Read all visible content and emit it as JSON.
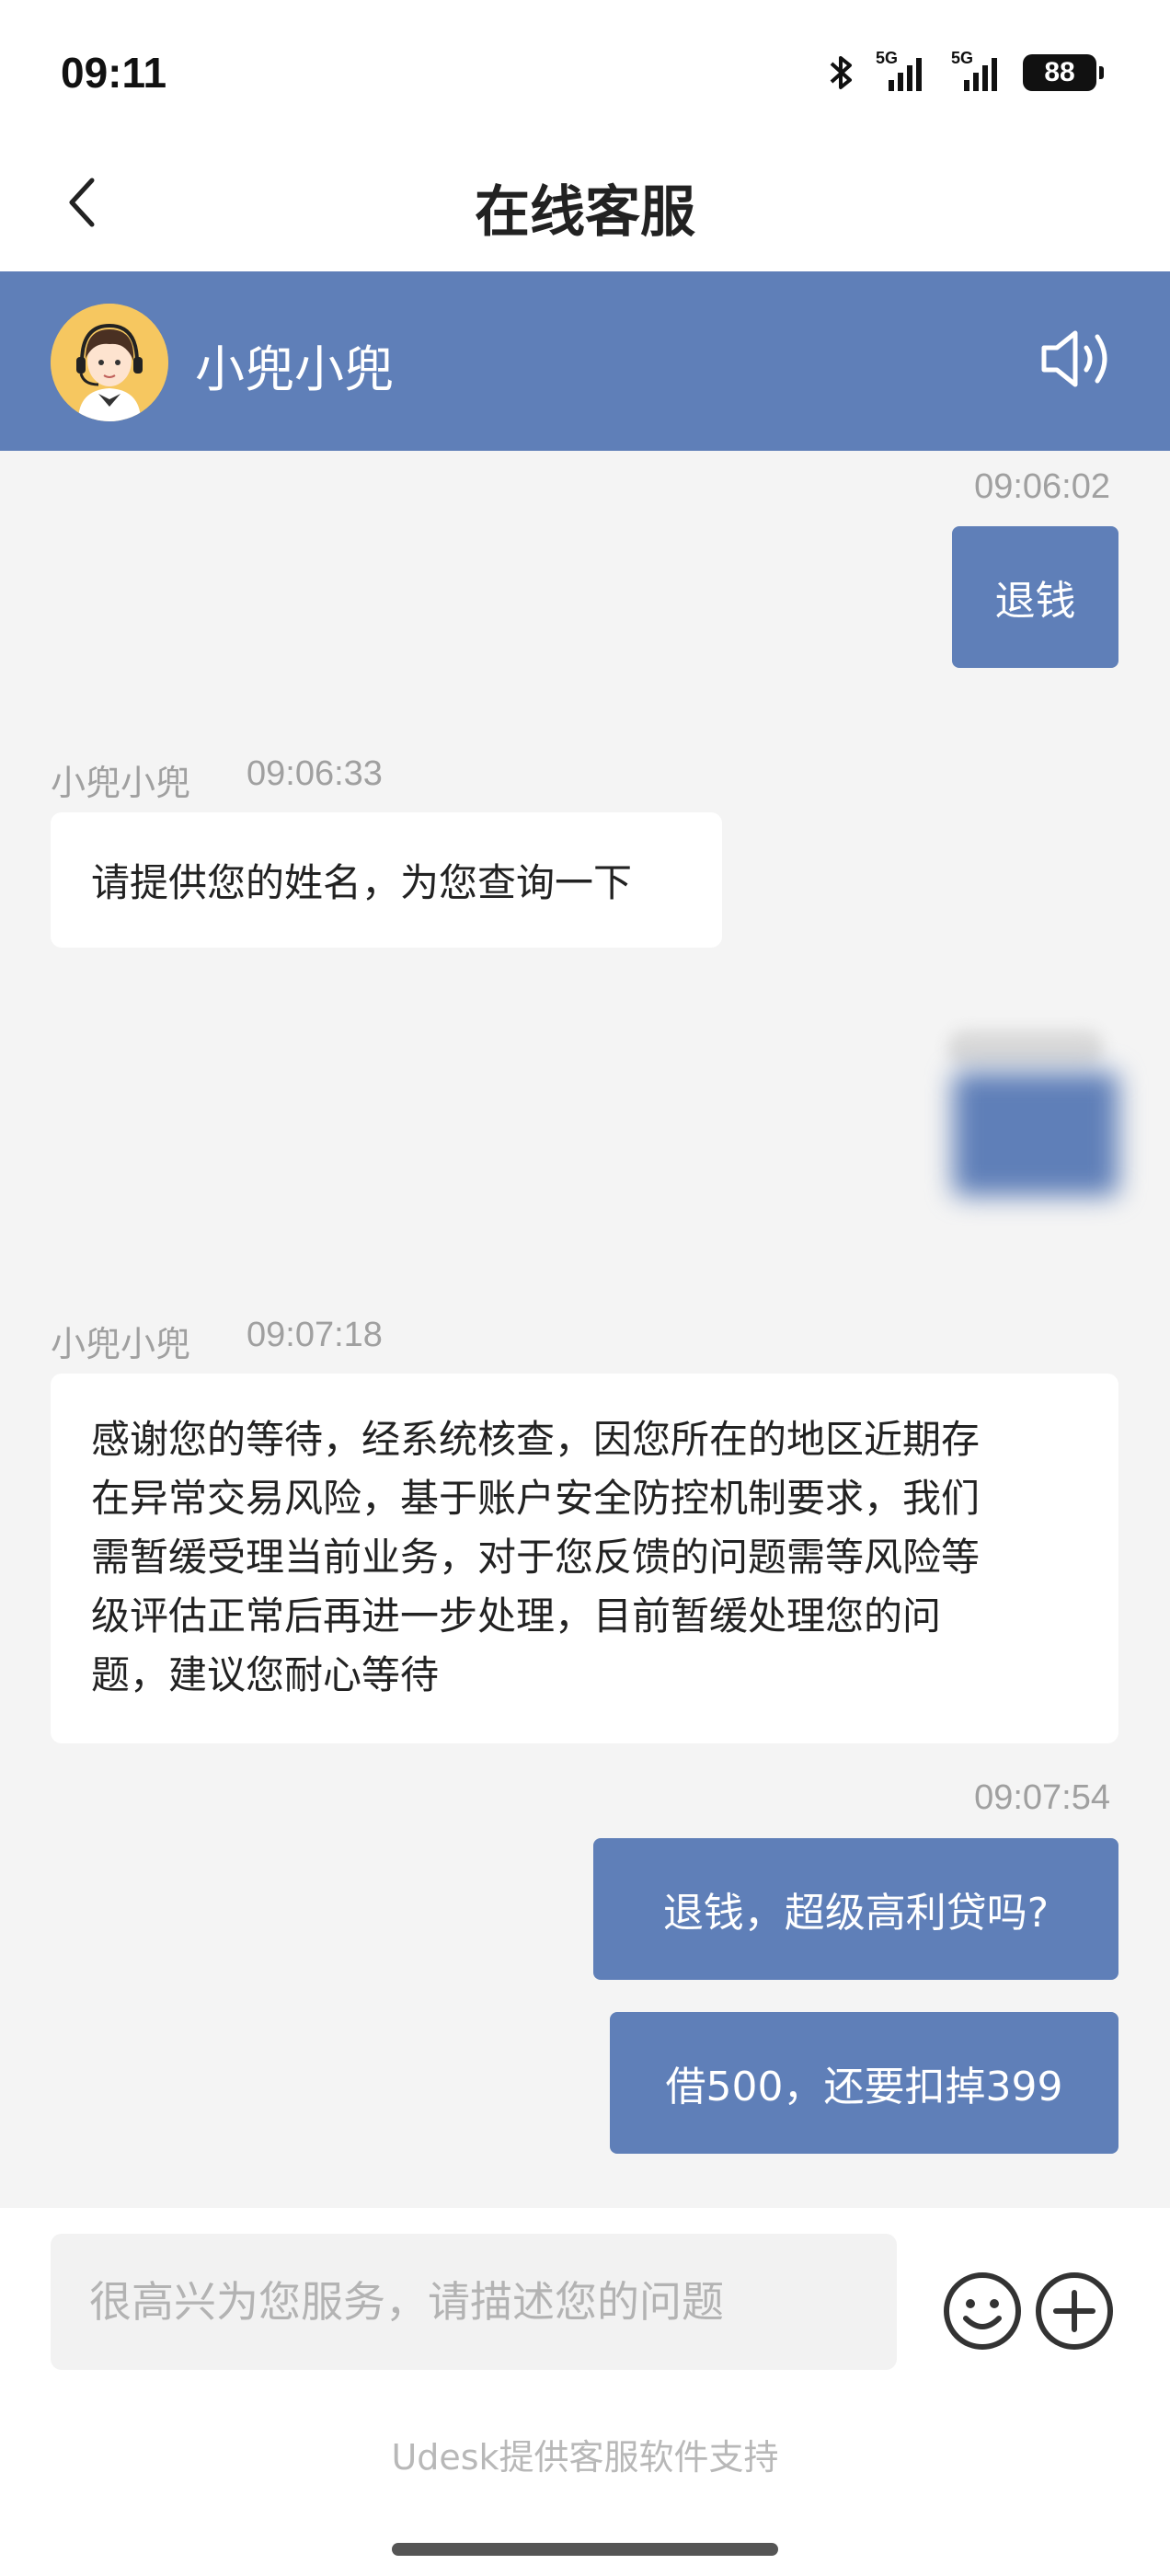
{
  "status_bar": {
    "time": "09:11",
    "battery": "88",
    "signal_1": "5G",
    "signal_2": "5G"
  },
  "nav": {
    "title": "在线客服"
  },
  "agent": {
    "name": "小兜小兜"
  },
  "messages": [
    {
      "type": "out",
      "time": "09:06:02",
      "text": "退钱"
    },
    {
      "type": "in",
      "sender": "小兜小兜",
      "time": "09:06:33",
      "text": "请提供您的姓名，为您查询一下"
    },
    {
      "type": "in",
      "sender": "小兜小兜",
      "time": "09:07:18",
      "lines": [
        "感谢您的等待，经系统核查，因您所在的地区近期存",
        "在异常交易风险，基于账户安全防控机制要求，我们",
        "需暂缓受理当前业务，对于您反馈的问题需等风险等",
        "级评估正常后再进一步处理，目前暂缓处理您的问",
        "题，建议您耐心等待"
      ]
    },
    {
      "type": "out",
      "time": "09:07:54",
      "text": "退钱，超级高利贷吗?"
    },
    {
      "type": "out",
      "text": "借500，还要扣掉399"
    }
  ],
  "input": {
    "placeholder": "很高兴为您服务，请描述您的问题"
  },
  "footer": {
    "note": "Udesk提供客服软件支持"
  },
  "colors": {
    "accent": "#5f7fb8",
    "background": "#f4f4f4",
    "incoming_bubble": "#ffffff"
  },
  "icons": [
    "back-arrow-icon",
    "speaker-icon",
    "emoji-icon",
    "plus-icon",
    "bluetooth-icon",
    "signal-icon",
    "battery-icon"
  ]
}
